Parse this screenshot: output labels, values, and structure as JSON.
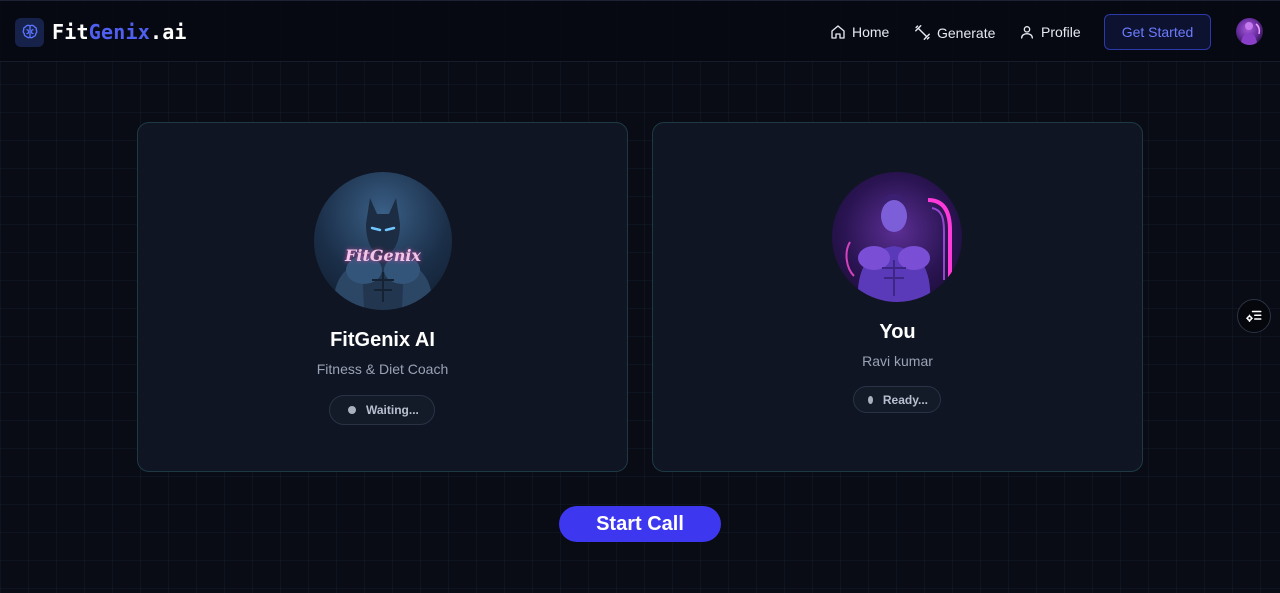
{
  "brand": {
    "part1": "Fit",
    "part2": "Genix",
    "part3": ".ai",
    "icon": "brain-icon"
  },
  "nav": {
    "home": "Home",
    "generate": "Generate",
    "profile": "Profile",
    "cta": "Get Started"
  },
  "ai_card": {
    "title": "FitGenix AI",
    "subtitle": "Fitness & Diet Coach",
    "status": "Waiting...",
    "avatar_caption": "FitGenix"
  },
  "user_card": {
    "title": "You",
    "subtitle": "Ravi kumar",
    "status": "Ready..."
  },
  "call": {
    "start_label": "Start Call"
  },
  "colors": {
    "accent": "#3d37f0",
    "brand_blue": "#4f5ff0",
    "background": "#090c15",
    "card": "#0f1522"
  }
}
